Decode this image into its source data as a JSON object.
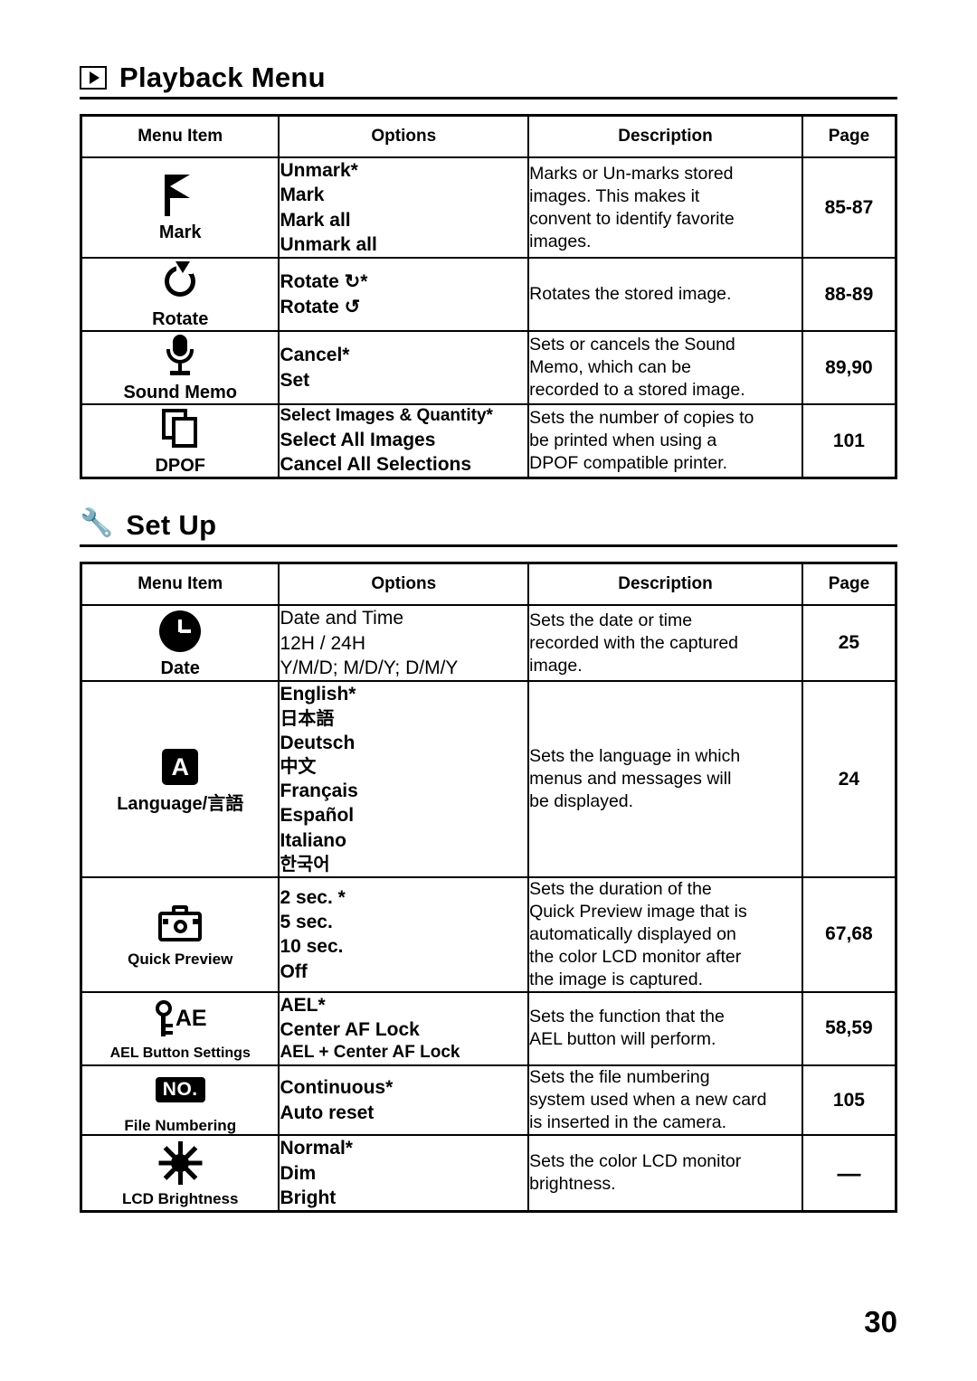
{
  "sections": [
    {
      "icon": "play-icon",
      "title": "Playback Menu",
      "headers": [
        "Menu Item",
        "Options",
        "Description",
        "Page"
      ],
      "rows": [
        {
          "item_label": "Mark",
          "item_icon": "flag-icon",
          "options": [
            "Unmark*",
            "Mark",
            "Mark all",
            "Unmark all"
          ],
          "description": [
            "Marks or Un-marks stored",
            "images. This makes it",
            "convent to identify favorite",
            "images."
          ],
          "page": "85-87"
        },
        {
          "item_label": "Rotate",
          "item_icon": "rotate-icon",
          "options": [
            "Rotate ↻*",
            "Rotate ↺"
          ],
          "description": [
            "Rotates the stored image."
          ],
          "page": "88-89"
        },
        {
          "item_label": "Sound Memo",
          "item_icon": "microphone-icon",
          "options": [
            "Cancel*",
            "Set"
          ],
          "description": [
            "Sets or cancels the Sound",
            "Memo, which can be",
            "recorded to a stored image."
          ],
          "page": "89,90"
        },
        {
          "item_label": "DPOF",
          "item_icon": "dpof-icon",
          "options": [
            "Select Images & Quantity*",
            "Select All Images",
            "Cancel All Selections"
          ],
          "description": [
            "Sets the number of copies to",
            "be printed when using a",
            "DPOF compatible printer."
          ],
          "page": "101"
        }
      ]
    },
    {
      "icon": "wrench-icon",
      "title": "Set Up",
      "headers": [
        "Menu Item",
        "Options",
        "Description",
        "Page"
      ],
      "rows": [
        {
          "item_label": "Date",
          "item_icon": "clock-icon",
          "options": [
            "Date and Time",
            "12H / 24H",
            "Y/M/D; M/D/Y; D/M/Y"
          ],
          "description": [
            "Sets the date or time",
            "recorded with the captured",
            "image."
          ],
          "page": "25"
        },
        {
          "item_label": "Language/言語",
          "item_icon": "language-icon",
          "options": [
            "English*",
            "日本語",
            "Deutsch",
            "中文",
            "Français",
            "Español",
            "Italiano",
            "한국어"
          ],
          "description": [
            "Sets the language in which",
            "menus and messages will",
            "be displayed."
          ],
          "page": "24"
        },
        {
          "item_label": "Quick Preview",
          "item_icon": "camera-icon",
          "options": [
            "2 sec. *",
            "5 sec.",
            "10 sec.",
            "Off"
          ],
          "description": [
            "Sets the duration of the",
            "Quick Preview image that is",
            "automatically displayed on",
            "the color LCD monitor after",
            "the image is captured."
          ],
          "page": "67,68"
        },
        {
          "item_label": "AEL Button Settings",
          "item_icon": "ael-key-icon",
          "options": [
            "AEL*",
            "Center AF Lock",
            "AEL + Center AF Lock"
          ],
          "description": [
            "Sets the function that the",
            "AEL button will perform."
          ],
          "page": "58,59"
        },
        {
          "item_label": "File Numbering",
          "item_icon": "number-icon",
          "options": [
            "Continuous*",
            "Auto reset"
          ],
          "description": [
            "Sets the file numbering",
            "system used when a new card",
            "is inserted in the camera."
          ],
          "page": "105"
        },
        {
          "item_label": "LCD Brightness",
          "item_icon": "brightness-icon",
          "options": [
            "Normal*",
            "Dim",
            "Bright"
          ],
          "description": [
            "Sets the color LCD monitor",
            "brightness."
          ],
          "page": "—"
        }
      ]
    }
  ],
  "folio": "30"
}
